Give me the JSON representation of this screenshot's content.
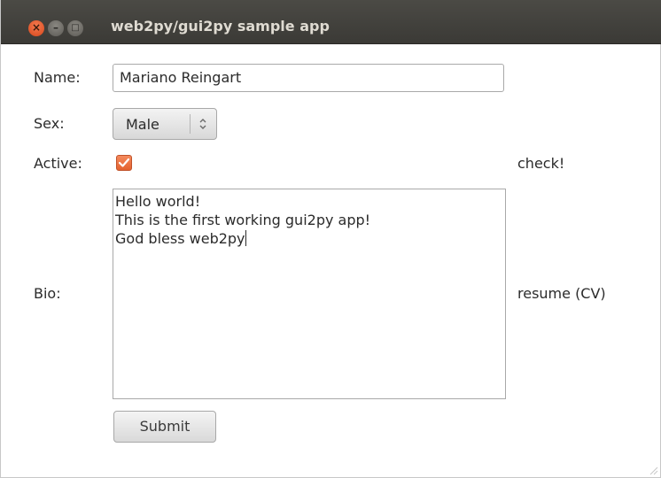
{
  "window": {
    "title": "web2py/gui2py sample app",
    "close_glyph": "×",
    "min_glyph": "–",
    "max_glyph": "□"
  },
  "form": {
    "name_label": "Name:",
    "name_value": "Mariano Reingart",
    "sex_label": "Sex:",
    "sex_value": "Male",
    "active_label": "Active:",
    "active_checked": true,
    "active_side_label": "check!",
    "bio_label": "Bio:",
    "bio_lines": [
      "Hello world!",
      "This is the first working gui2py app!",
      "God bless web2py"
    ],
    "bio_side_label": "resume (CV)",
    "submit_label": "Submit"
  },
  "colors": {
    "titlebar": "#3c3b37",
    "close_button": "#e05a2b",
    "checkbox_accent": "#e4622f"
  }
}
